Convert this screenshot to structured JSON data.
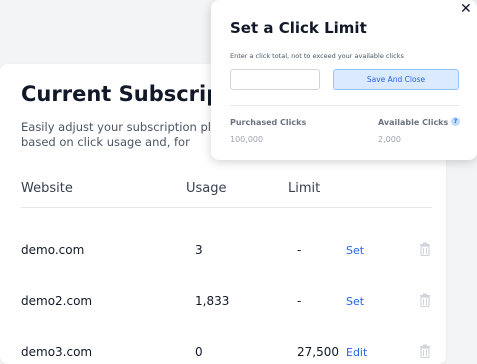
{
  "subscription": {
    "title": "Current Subscription",
    "description": "Easily adjust your subscription plan and click limits. Billing is pro-rated based on click usage and, for",
    "columns": [
      "Website",
      "Usage",
      "Limit"
    ],
    "rows": [
      {
        "website": "demo.com",
        "usage": "3",
        "limit": "-",
        "action": "Set"
      },
      {
        "website": "demo2.com",
        "usage": "1,833",
        "limit": "-",
        "action": "Set"
      },
      {
        "website": "demo3.com",
        "usage": "0",
        "limit": "27,500",
        "action": "Edit"
      }
    ]
  },
  "modal": {
    "title": "Set a Click Limit",
    "hint": "Enter a click total, not to exceed your available clicks",
    "input_value": "",
    "save_label": "Save And Close",
    "purchased_label": "Purchased Clicks",
    "purchased_value": "100,000",
    "available_label": "Available Clicks",
    "available_value": "2,000",
    "close_symbol": "✕",
    "info_symbol": "?"
  },
  "icons": {
    "close": "close-icon",
    "trash": "trash-icon",
    "info": "info-icon"
  },
  "colors": {
    "link": "#2563eb",
    "button_bg": "#dbeafe",
    "button_border": "#93c5fd"
  }
}
